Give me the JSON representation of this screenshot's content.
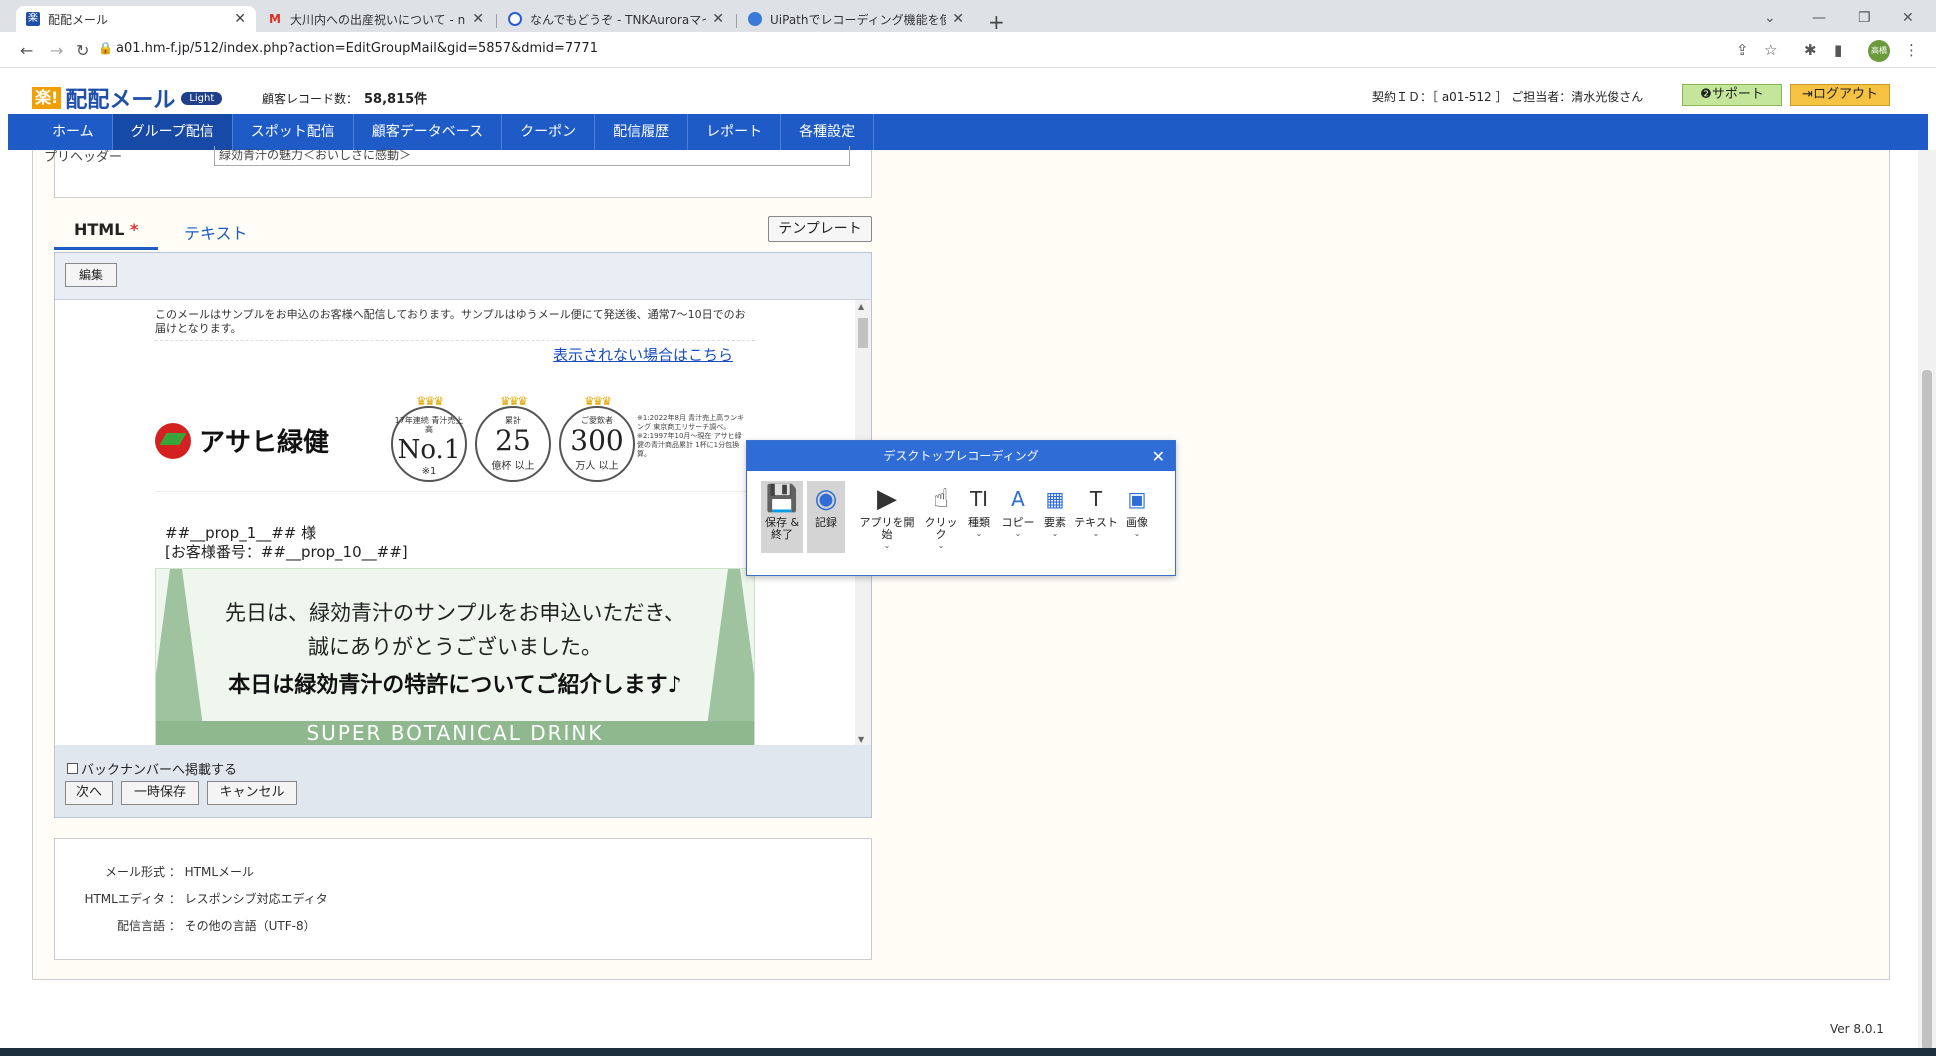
{
  "browser": {
    "tabs": [
      {
        "title": "配配メール",
        "icon": "haihai-favicon"
      },
      {
        "title": "大川内への出産祝いについて - na.ai",
        "icon": "gmail-icon"
      },
      {
        "title": "なんでもどうぞ - TNKAuroraマイグレ",
        "icon": "blue-circle-icon"
      },
      {
        "title": "UiPathでレコーディング機能を使ってW",
        "icon": "globe-icon"
      }
    ],
    "url": "a01.hm-f.jp/512/index.php?action=EditGroupMail&gid=5857&dmid=7771",
    "avatar_text": "高橋"
  },
  "header": {
    "logo_badge": "楽!",
    "logo_name": "配配メール",
    "logo_plan": "Light",
    "record_label": "顧客レコード数：",
    "record_count": "58,815件",
    "contract": "契約ＩＤ：［ a01-512 ］ ご担当者：清水光俊さん",
    "support_label": "❷サポート",
    "logout_label": "ログアウト"
  },
  "nav": [
    "ホーム",
    "グループ配信",
    "スポット配信",
    "顧客データベース",
    "クーポン",
    "配信履歴",
    "レポート",
    "各種設定"
  ],
  "preheader": {
    "label": "プリヘッダー",
    "value": "緑効青汁の魅力＜おいしさに感動＞"
  },
  "editor": {
    "tab_html": "HTML",
    "tab_html_required": "*",
    "tab_text": "テキスト",
    "template_label": "テンプレート",
    "edit_label": "編集",
    "backnumber_label": "バックナンバーへ掲載する",
    "next_label": "次へ",
    "save_label": "一時保存",
    "cancel_label": "キャンセル"
  },
  "mail": {
    "notice": "このメールはサンプルをお申込のお客様へ配信しております。サンプルはゆうメール便にて発送後、通常7〜10日でのお届けとなります。",
    "view_link": "表示されない場合はこちら",
    "brand": "アサヒ緑健",
    "medals": [
      {
        "small": "17年連続 青汁売上高",
        "big": "No.1",
        "unit": "※1"
      },
      {
        "small": "累計",
        "big": "25",
        "unit": "億杯 以上"
      },
      {
        "small": "ご愛飲者",
        "big": "300",
        "unit": "万人 以上"
      }
    ],
    "footnote": "※1:2022年8月 青汁売上高ランキング 東京商工リサーチ調べ。 ※2:1997年10月〜現在 アサヒ緑健の青汁商品累計 1杯に1分包換算。",
    "greeting_line1": "##__prop_1__## 様",
    "greeting_line2": "[お客様番号：##__prop_10__##]",
    "banner_line1": "先日は、緑効青汁のサンプルをお申込いただき、",
    "banner_line2": "誠にありがとうございました。",
    "banner_line3": "本日は緑効青汁の特許についてご紹介します♪",
    "banner_line4": "SUPER BOTANICAL DRINK"
  },
  "info": [
    {
      "key": "メール形式",
      "value": "HTMLメール"
    },
    {
      "key": "HTMLエディタ",
      "value": "レスポンシブ対応エディタ"
    },
    {
      "key": "配信言語",
      "value": "その他の言語（UTF-8）"
    }
  ],
  "version": "Ver 8.0.1",
  "recorder": {
    "title": "デスクトップレコーディング",
    "buttons": [
      {
        "label": "保存 & 終了",
        "icon": "save-icon"
      },
      {
        "label": "記録",
        "icon": "record-icon"
      },
      {
        "label": "アプリを開始",
        "icon": "play-icon"
      },
      {
        "label": "クリック",
        "icon": "click-icon"
      },
      {
        "label": "種類",
        "icon": "type-icon"
      },
      {
        "label": "コピー",
        "icon": "copy-icon"
      },
      {
        "label": "要素",
        "icon": "element-icon"
      },
      {
        "label": "テキスト",
        "icon": "text-icon"
      },
      {
        "label": "画像",
        "icon": "image-icon"
      }
    ]
  }
}
